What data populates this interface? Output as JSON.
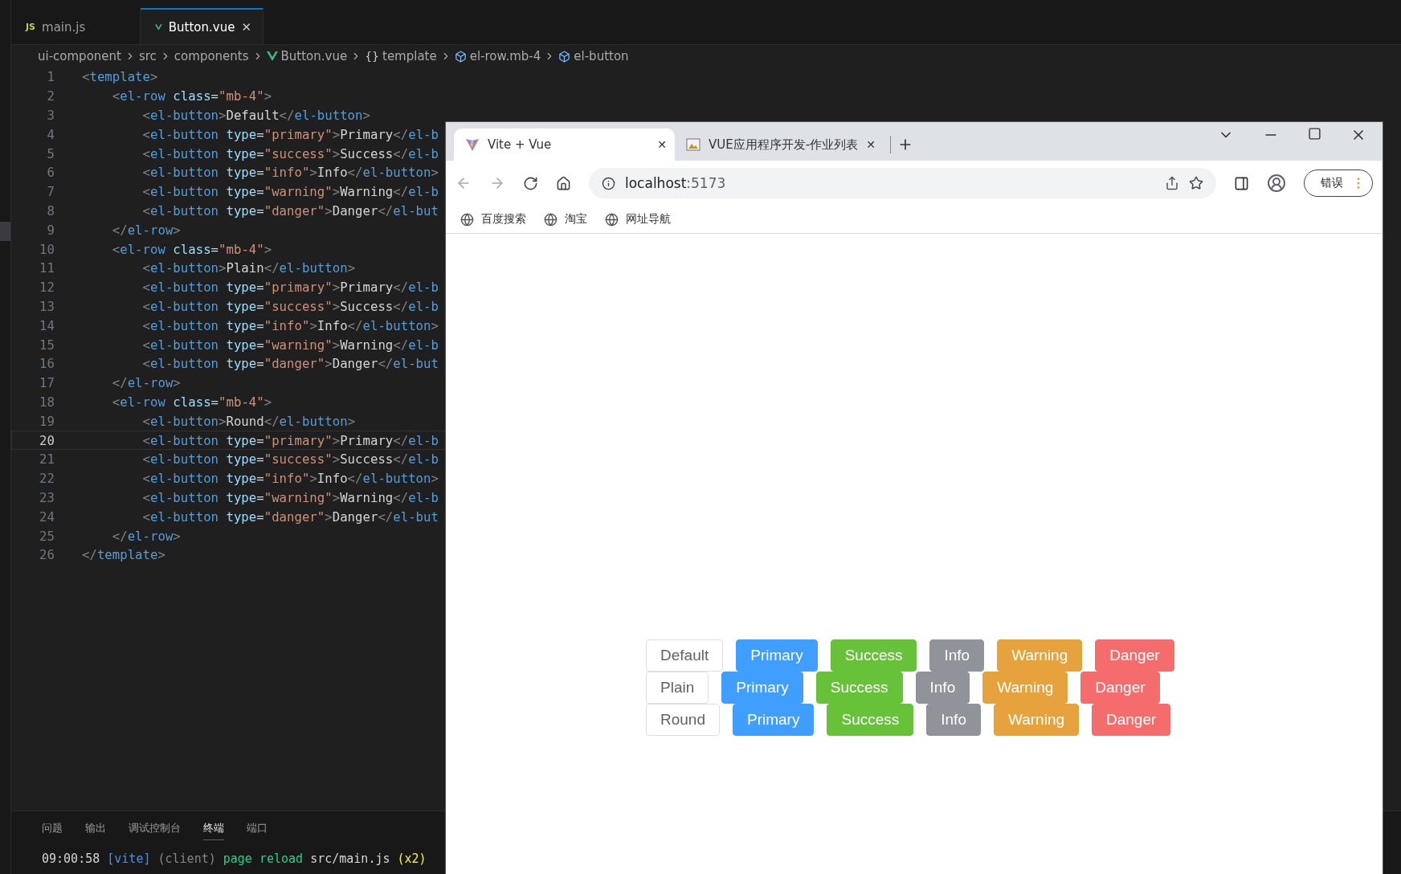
{
  "editor": {
    "tabs": [
      {
        "kind": "js",
        "icon_text": "JS",
        "label": "main.js",
        "selected": false
      },
      {
        "kind": "vue",
        "label": "Button.vue",
        "selected": true,
        "close": "✕"
      }
    ],
    "breadcrumb": [
      {
        "kind": "plain",
        "label": "ui-component"
      },
      {
        "kind": "plain",
        "label": "src"
      },
      {
        "kind": "plain",
        "label": "components"
      },
      {
        "kind": "vue",
        "label": "Button.vue"
      },
      {
        "kind": "braces",
        "icon_text": "{}",
        "label": "template"
      },
      {
        "kind": "cube",
        "label": "el-row.mb-4"
      },
      {
        "kind": "cube",
        "label": "el-button"
      }
    ],
    "lines": [
      {
        "number": "1",
        "current": false,
        "tokens": [
          {
            "kind": "punct",
            "text": "<"
          },
          {
            "kind": "tag",
            "text": "template"
          },
          {
            "kind": "punct",
            "text": ">"
          }
        ]
      },
      {
        "number": "2",
        "current": false,
        "tokens": [
          {
            "kind": "punct",
            "text": "    <"
          },
          {
            "kind": "tag",
            "text": "el-row "
          },
          {
            "kind": "attr",
            "text": "class"
          },
          {
            "kind": "text",
            "text": "="
          },
          {
            "kind": "string",
            "text": "\"mb-4\""
          },
          {
            "kind": "punct",
            "text": ">"
          }
        ]
      },
      {
        "number": "3",
        "current": false,
        "tokens": [
          {
            "kind": "punct",
            "text": "        <"
          },
          {
            "kind": "tag",
            "text": "el-button"
          },
          {
            "kind": "punct",
            "text": ">"
          },
          {
            "kind": "text",
            "text": "Default"
          },
          {
            "kind": "punct",
            "text": "</"
          },
          {
            "kind": "tag",
            "text": "el-button"
          },
          {
            "kind": "punct",
            "text": ">"
          }
        ]
      },
      {
        "number": "4",
        "current": false,
        "tokens": [
          {
            "kind": "punct",
            "text": "        <"
          },
          {
            "kind": "tag",
            "text": "el-button "
          },
          {
            "kind": "attr",
            "text": "type"
          },
          {
            "kind": "text",
            "text": "="
          },
          {
            "kind": "string",
            "text": "\"primary\""
          },
          {
            "kind": "punct",
            "text": ">"
          },
          {
            "kind": "text",
            "text": "Primary"
          },
          {
            "kind": "punct",
            "text": "</"
          },
          {
            "kind": "tag",
            "text": "el-b"
          }
        ]
      },
      {
        "number": "5",
        "current": false,
        "tokens": [
          {
            "kind": "punct",
            "text": "        <"
          },
          {
            "kind": "tag",
            "text": "el-button "
          },
          {
            "kind": "attr",
            "text": "type"
          },
          {
            "kind": "text",
            "text": "="
          },
          {
            "kind": "string",
            "text": "\"success\""
          },
          {
            "kind": "punct",
            "text": ">"
          },
          {
            "kind": "text",
            "text": "Success"
          },
          {
            "kind": "punct",
            "text": "</"
          },
          {
            "kind": "tag",
            "text": "el-b"
          }
        ]
      },
      {
        "number": "6",
        "current": false,
        "tokens": [
          {
            "kind": "punct",
            "text": "        <"
          },
          {
            "kind": "tag",
            "text": "el-button "
          },
          {
            "kind": "attr",
            "text": "type"
          },
          {
            "kind": "text",
            "text": "="
          },
          {
            "kind": "string",
            "text": "\"info\""
          },
          {
            "kind": "punct",
            "text": ">"
          },
          {
            "kind": "text",
            "text": "Info"
          },
          {
            "kind": "punct",
            "text": "</"
          },
          {
            "kind": "tag",
            "text": "el-button"
          },
          {
            "kind": "punct",
            "text": ">"
          }
        ]
      },
      {
        "number": "7",
        "current": false,
        "tokens": [
          {
            "kind": "punct",
            "text": "        <"
          },
          {
            "kind": "tag",
            "text": "el-button "
          },
          {
            "kind": "attr",
            "text": "type"
          },
          {
            "kind": "text",
            "text": "="
          },
          {
            "kind": "string",
            "text": "\"warning\""
          },
          {
            "kind": "punct",
            "text": ">"
          },
          {
            "kind": "text",
            "text": "Warning"
          },
          {
            "kind": "punct",
            "text": "</"
          },
          {
            "kind": "tag",
            "text": "el-b"
          }
        ]
      },
      {
        "number": "8",
        "current": false,
        "tokens": [
          {
            "kind": "punct",
            "text": "        <"
          },
          {
            "kind": "tag",
            "text": "el-button "
          },
          {
            "kind": "attr",
            "text": "type"
          },
          {
            "kind": "text",
            "text": "="
          },
          {
            "kind": "string",
            "text": "\"danger\""
          },
          {
            "kind": "punct",
            "text": ">"
          },
          {
            "kind": "text",
            "text": "Danger"
          },
          {
            "kind": "punct",
            "text": "</"
          },
          {
            "kind": "tag",
            "text": "el-but"
          }
        ]
      },
      {
        "number": "9",
        "current": false,
        "tokens": [
          {
            "kind": "punct",
            "text": "    </"
          },
          {
            "kind": "tag",
            "text": "el-row"
          },
          {
            "kind": "punct",
            "text": ">"
          }
        ]
      },
      {
        "number": "10",
        "current": false,
        "tokens": [
          {
            "kind": "punct",
            "text": "    <"
          },
          {
            "kind": "tag",
            "text": "el-row "
          },
          {
            "kind": "attr",
            "text": "class"
          },
          {
            "kind": "text",
            "text": "="
          },
          {
            "kind": "string",
            "text": "\"mb-4\""
          },
          {
            "kind": "punct",
            "text": ">"
          }
        ]
      },
      {
        "number": "11",
        "current": false,
        "tokens": [
          {
            "kind": "punct",
            "text": "        <"
          },
          {
            "kind": "tag",
            "text": "el-button"
          },
          {
            "kind": "punct",
            "text": ">"
          },
          {
            "kind": "text",
            "text": "Plain"
          },
          {
            "kind": "punct",
            "text": "</"
          },
          {
            "kind": "tag",
            "text": "el-button"
          },
          {
            "kind": "punct",
            "text": ">"
          }
        ]
      },
      {
        "number": "12",
        "current": false,
        "tokens": [
          {
            "kind": "punct",
            "text": "        <"
          },
          {
            "kind": "tag",
            "text": "el-button "
          },
          {
            "kind": "attr",
            "text": "type"
          },
          {
            "kind": "text",
            "text": "="
          },
          {
            "kind": "string",
            "text": "\"primary\""
          },
          {
            "kind": "punct",
            "text": ">"
          },
          {
            "kind": "text",
            "text": "Primary"
          },
          {
            "kind": "punct",
            "text": "</"
          },
          {
            "kind": "tag",
            "text": "el-b"
          }
        ]
      },
      {
        "number": "13",
        "current": false,
        "tokens": [
          {
            "kind": "punct",
            "text": "        <"
          },
          {
            "kind": "tag",
            "text": "el-button "
          },
          {
            "kind": "attr",
            "text": "type"
          },
          {
            "kind": "text",
            "text": "="
          },
          {
            "kind": "string",
            "text": "\"success\""
          },
          {
            "kind": "punct",
            "text": ">"
          },
          {
            "kind": "text",
            "text": "Success"
          },
          {
            "kind": "punct",
            "text": "</"
          },
          {
            "kind": "tag",
            "text": "el-b"
          }
        ]
      },
      {
        "number": "14",
        "current": false,
        "tokens": [
          {
            "kind": "punct",
            "text": "        <"
          },
          {
            "kind": "tag",
            "text": "el-button "
          },
          {
            "kind": "attr",
            "text": "type"
          },
          {
            "kind": "text",
            "text": "="
          },
          {
            "kind": "string",
            "text": "\"info\""
          },
          {
            "kind": "punct",
            "text": ">"
          },
          {
            "kind": "text",
            "text": "Info"
          },
          {
            "kind": "punct",
            "text": "</"
          },
          {
            "kind": "tag",
            "text": "el-button"
          },
          {
            "kind": "punct",
            "text": ">"
          }
        ]
      },
      {
        "number": "15",
        "current": false,
        "tokens": [
          {
            "kind": "punct",
            "text": "        <"
          },
          {
            "kind": "tag",
            "text": "el-button "
          },
          {
            "kind": "attr",
            "text": "type"
          },
          {
            "kind": "text",
            "text": "="
          },
          {
            "kind": "string",
            "text": "\"warning\""
          },
          {
            "kind": "punct",
            "text": ">"
          },
          {
            "kind": "text",
            "text": "Warning"
          },
          {
            "kind": "punct",
            "text": "</"
          },
          {
            "kind": "tag",
            "text": "el-b"
          }
        ]
      },
      {
        "number": "16",
        "current": false,
        "tokens": [
          {
            "kind": "punct",
            "text": "        <"
          },
          {
            "kind": "tag",
            "text": "el-button "
          },
          {
            "kind": "attr",
            "text": "type"
          },
          {
            "kind": "text",
            "text": "="
          },
          {
            "kind": "string",
            "text": "\"danger\""
          },
          {
            "kind": "punct",
            "text": ">"
          },
          {
            "kind": "text",
            "text": "Danger"
          },
          {
            "kind": "punct",
            "text": "</"
          },
          {
            "kind": "tag",
            "text": "el-but"
          }
        ]
      },
      {
        "number": "17",
        "current": false,
        "tokens": [
          {
            "kind": "punct",
            "text": "    </"
          },
          {
            "kind": "tag",
            "text": "el-row"
          },
          {
            "kind": "punct",
            "text": ">"
          }
        ]
      },
      {
        "number": "18",
        "current": false,
        "tokens": [
          {
            "kind": "punct",
            "text": "    <"
          },
          {
            "kind": "tag",
            "text": "el-row "
          },
          {
            "kind": "attr",
            "text": "class"
          },
          {
            "kind": "text",
            "text": "="
          },
          {
            "kind": "string",
            "text": "\"mb-4\""
          },
          {
            "kind": "punct",
            "text": ">"
          }
        ]
      },
      {
        "number": "19",
        "current": false,
        "tokens": [
          {
            "kind": "punct",
            "text": "        <"
          },
          {
            "kind": "tag",
            "text": "el-button"
          },
          {
            "kind": "punct",
            "text": ">"
          },
          {
            "kind": "text",
            "text": "Round"
          },
          {
            "kind": "punct",
            "text": "</"
          },
          {
            "kind": "tag",
            "text": "el-button"
          },
          {
            "kind": "punct",
            "text": ">"
          }
        ]
      },
      {
        "number": "20",
        "current": true,
        "tokens": [
          {
            "kind": "punct",
            "text": "        <"
          },
          {
            "kind": "tag",
            "text": "el-button "
          },
          {
            "kind": "attr",
            "text": "type"
          },
          {
            "kind": "text",
            "text": "="
          },
          {
            "kind": "string",
            "text": "\"primary\""
          },
          {
            "kind": "punct",
            "text": ">"
          },
          {
            "kind": "text",
            "text": "Primary"
          },
          {
            "kind": "punct",
            "text": "</"
          },
          {
            "kind": "tag",
            "text": "el-b"
          }
        ]
      },
      {
        "number": "21",
        "current": false,
        "tokens": [
          {
            "kind": "punct",
            "text": "        <"
          },
          {
            "kind": "tag",
            "text": "el-button "
          },
          {
            "kind": "attr",
            "text": "type"
          },
          {
            "kind": "text",
            "text": "="
          },
          {
            "kind": "string",
            "text": "\"success\""
          },
          {
            "kind": "punct",
            "text": ">"
          },
          {
            "kind": "text",
            "text": "Success"
          },
          {
            "kind": "punct",
            "text": "</"
          },
          {
            "kind": "tag",
            "text": "el-b"
          }
        ]
      },
      {
        "number": "22",
        "current": false,
        "tokens": [
          {
            "kind": "punct",
            "text": "        <"
          },
          {
            "kind": "tag",
            "text": "el-button "
          },
          {
            "kind": "attr",
            "text": "type"
          },
          {
            "kind": "text",
            "text": "="
          },
          {
            "kind": "string",
            "text": "\"info\""
          },
          {
            "kind": "punct",
            "text": ">"
          },
          {
            "kind": "text",
            "text": "Info"
          },
          {
            "kind": "punct",
            "text": "</"
          },
          {
            "kind": "tag",
            "text": "el-button"
          },
          {
            "kind": "punct",
            "text": ">"
          }
        ]
      },
      {
        "number": "23",
        "current": false,
        "tokens": [
          {
            "kind": "punct",
            "text": "        <"
          },
          {
            "kind": "tag",
            "text": "el-button "
          },
          {
            "kind": "attr",
            "text": "type"
          },
          {
            "kind": "text",
            "text": "="
          },
          {
            "kind": "string",
            "text": "\"warning\""
          },
          {
            "kind": "punct",
            "text": ">"
          },
          {
            "kind": "text",
            "text": "Warning"
          },
          {
            "kind": "punct",
            "text": "</"
          },
          {
            "kind": "tag",
            "text": "el-b"
          }
        ]
      },
      {
        "number": "24",
        "current": false,
        "tokens": [
          {
            "kind": "punct",
            "text": "        <"
          },
          {
            "kind": "tag",
            "text": "el-button "
          },
          {
            "kind": "attr",
            "text": "type"
          },
          {
            "kind": "text",
            "text": "="
          },
          {
            "kind": "string",
            "text": "\"danger\""
          },
          {
            "kind": "punct",
            "text": ">"
          },
          {
            "kind": "text",
            "text": "Danger"
          },
          {
            "kind": "punct",
            "text": "</"
          },
          {
            "kind": "tag",
            "text": "el-but"
          }
        ]
      },
      {
        "number": "25",
        "current": false,
        "tokens": [
          {
            "kind": "punct",
            "text": "    </"
          },
          {
            "kind": "tag",
            "text": "el-row"
          },
          {
            "kind": "punct",
            "text": ">"
          }
        ]
      },
      {
        "number": "26",
        "current": false,
        "tokens": [
          {
            "kind": "punct",
            "text": "</"
          },
          {
            "kind": "tag",
            "text": "template"
          },
          {
            "kind": "punct",
            "text": ">"
          }
        ]
      }
    ],
    "panel_tabs": [
      {
        "label": "问题",
        "selected": false
      },
      {
        "label": "输出",
        "selected": false
      },
      {
        "label": "调试控制台",
        "selected": false
      },
      {
        "label": "终端",
        "selected": true
      },
      {
        "label": "端口",
        "selected": false
      }
    ],
    "terminal": [
      {
        "kind": "text",
        "text": "09:00:58 "
      },
      {
        "kind": "vite",
        "text": "[vite]"
      },
      {
        "kind": "dim",
        "text": " (client) "
      },
      {
        "kind": "green",
        "text": "page reload "
      },
      {
        "kind": "text",
        "text": "src/main.js "
      },
      {
        "kind": "yellow",
        "text": "(x2)"
      }
    ]
  },
  "browser": {
    "tabs": [
      {
        "kind": "vite",
        "title": "Vite + Vue",
        "selected": true,
        "close": "✕"
      },
      {
        "kind": "picture",
        "title": "VUE应用程序开发-作业列表",
        "selected": false,
        "close": "✕"
      }
    ],
    "address": {
      "host": "localhost",
      "port": ":5173"
    },
    "error_button": "错误",
    "bookmarks": [
      "百度搜索",
      "淘宝",
      "网址导航"
    ],
    "button_rows": [
      [
        {
          "kind": "default",
          "label": "Default"
        },
        {
          "kind": "primary",
          "label": "Primary"
        },
        {
          "kind": "success",
          "label": "Success"
        },
        {
          "kind": "info",
          "label": "Info"
        },
        {
          "kind": "warning",
          "label": "Warning"
        },
        {
          "kind": "danger",
          "label": "Danger"
        }
      ],
      [
        {
          "kind": "default",
          "label": "Plain"
        },
        {
          "kind": "primary",
          "label": "Primary"
        },
        {
          "kind": "success",
          "label": "Success"
        },
        {
          "kind": "info",
          "label": "Info"
        },
        {
          "kind": "warning",
          "label": "Warning"
        },
        {
          "kind": "danger",
          "label": "Danger"
        }
      ],
      [
        {
          "kind": "default",
          "label": "Round"
        },
        {
          "kind": "primary",
          "label": "Primary"
        },
        {
          "kind": "success",
          "label": "Success"
        },
        {
          "kind": "info",
          "label": "Info"
        },
        {
          "kind": "warning",
          "label": "Warning"
        },
        {
          "kind": "danger",
          "label": "Danger"
        }
      ]
    ]
  }
}
